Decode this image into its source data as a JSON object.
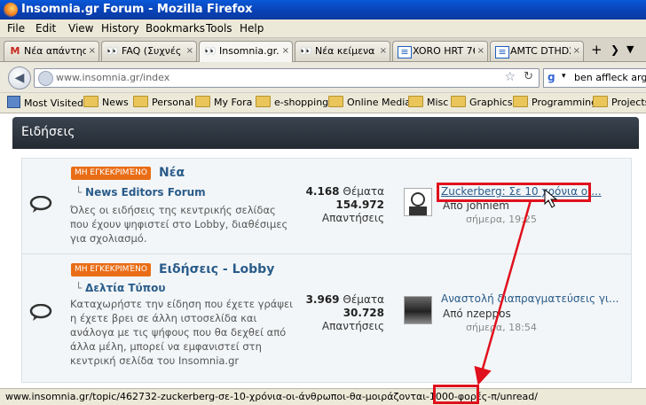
{
  "window": {
    "title": "Insomnia.gr Forum - Mozilla Firefox"
  },
  "menu": [
    "File",
    "Edit",
    "View",
    "History",
    "Bookmarks",
    "Tools",
    "Help"
  ],
  "tabs": [
    {
      "icon": "gmail-icon",
      "glyph": "M",
      "label": "Νέα απάντηση ..."
    },
    {
      "icon": "insomnia-icon",
      "glyph": "👀",
      "label": "FAQ (Συχνές ε..."
    },
    {
      "icon": "insomnia-icon",
      "glyph": "👀",
      "label": "Insomnia.gr..."
    },
    {
      "icon": "insomnia-icon",
      "glyph": "👀",
      "label": "Νέα κείμενα m..."
    },
    {
      "icon": "greek-flag-icon",
      "glyph": "≡",
      "label": "XORO HRT 760..."
    },
    {
      "icon": "greek-flag-icon",
      "glyph": "≡",
      "label": "AMTC DTHD29..."
    }
  ],
  "nav": {
    "url": "www.insomnia.gr/index",
    "search": "ben affleck argo"
  },
  "bookmarks": [
    "Most Visited",
    "News",
    "Personal",
    "My Fora",
    "e-shopping",
    "Online Media",
    "Misc",
    "Graphics",
    "Programming",
    "Projects"
  ],
  "section": {
    "title": "Ειδήσεις"
  },
  "forums": [
    {
      "badge": "ΜΗ ΕΓΚΕΚΡΙΜΈΝΟ",
      "title": "Νέα",
      "sub": "News Editors Forum",
      "desc": "Όλες οι ειδήσεις της κεντρικής σελίδας που έχουν ψηφιστεί στο Lobby, διαθέσιμες για σχολιασμό.",
      "topics_count": "4.168",
      "topics_label": "Θέματα",
      "replies_count": "154.972",
      "replies_label": "Απαντήσεις",
      "last_title": "Zuckerberg: Σε 10 χρόνια οι...",
      "last_by_prefix": "Από",
      "last_by": "johniem",
      "last_time": "σήμερα, 19:25"
    },
    {
      "badge": "ΜΗ ΕΓΚΕΚΡΙΜΈΝΟ",
      "title": "Ειδήσεις - Lobby",
      "sub": "Δελτία Τύπου",
      "desc": "Καταχωρήστε την είδηση που έχετε γράψει η έχετε βρει σε άλλη ιστοσελίδα και ανάλογα με τις ψήφους που θα δεχθεί από άλλα μέλη, μπορεί να εμφανιστεί στη κεντρική σελίδα του Insomnia.gr",
      "topics_count": "3.969",
      "topics_label": "Θέματα",
      "replies_count": "30.728",
      "replies_label": "Απαντήσεις",
      "last_title": "Αναστολή διαπραγματεύσεις γι...",
      "last_by_prefix": "Από",
      "last_by": "nzeppos",
      "last_time": "σήμερα, 18:54"
    }
  ],
  "status": {
    "text": "www.insomnia.gr/topic/462732-zuckerberg-σε-10-χρόνια-οι-άνθρωποι-θα-μοιράζονται-1000-φορές-π/unread/"
  },
  "colors": {
    "annotation": "#e0101c",
    "badge": "#e96d16",
    "link": "#2a5c8a"
  }
}
